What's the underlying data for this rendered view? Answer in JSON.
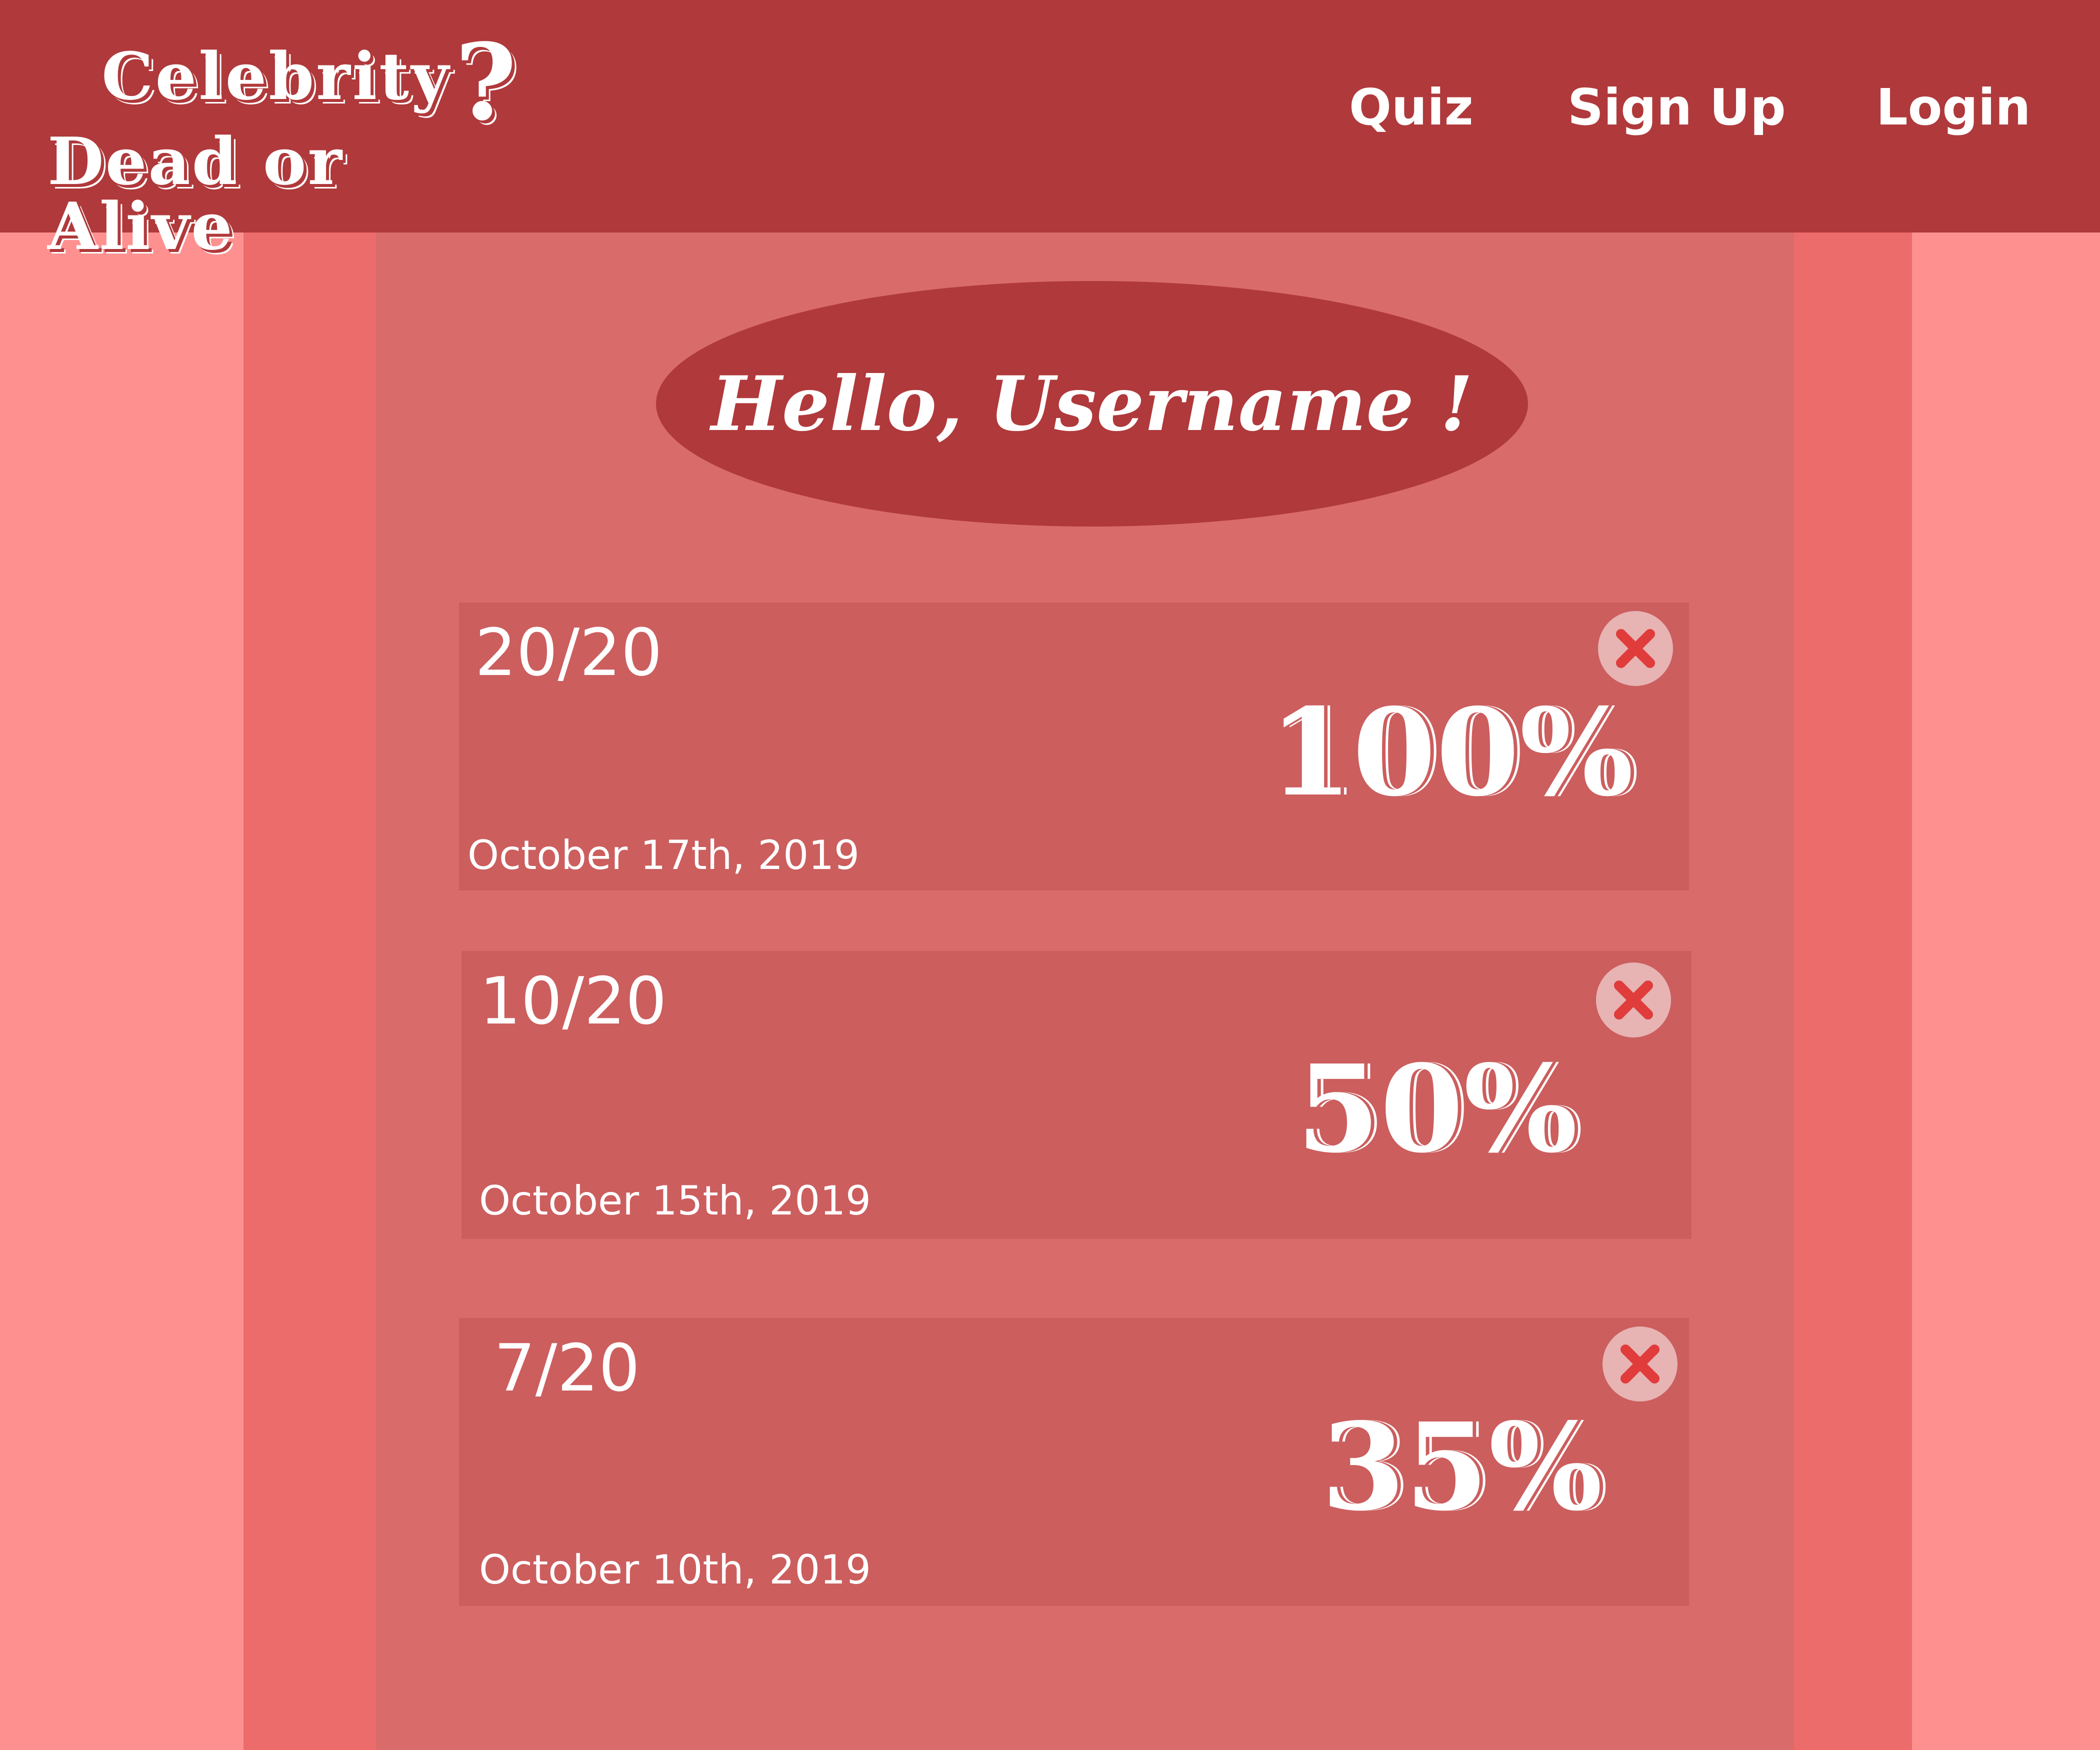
{
  "header": {
    "logo": {
      "line1": "Celebrity",
      "mark": "?",
      "line2": "Dead or Alive"
    },
    "nav": {
      "quiz": "Quiz",
      "signup": "Sign Up",
      "login": "Login"
    }
  },
  "greeting": "Hello, Username !",
  "results": [
    {
      "score": "20/20",
      "percent": "100%",
      "date": "October 17th, 2019"
    },
    {
      "score": "10/20",
      "percent": "50%",
      "date": "October 15th, 2019"
    },
    {
      "score": "7/20",
      "percent": "35%",
      "date": "October 10th, 2019"
    }
  ],
  "colors": {
    "header": "#b0393b",
    "page_background": "#fe9190",
    "side_band": "#ec6b6b",
    "panel": "#d96b6b",
    "card": "#cc5e5e",
    "delete_button_bg": "#e7b3b3",
    "delete_icon": "#e03c3c",
    "text": "#ffffff"
  },
  "icons": {
    "delete": "close-icon"
  }
}
